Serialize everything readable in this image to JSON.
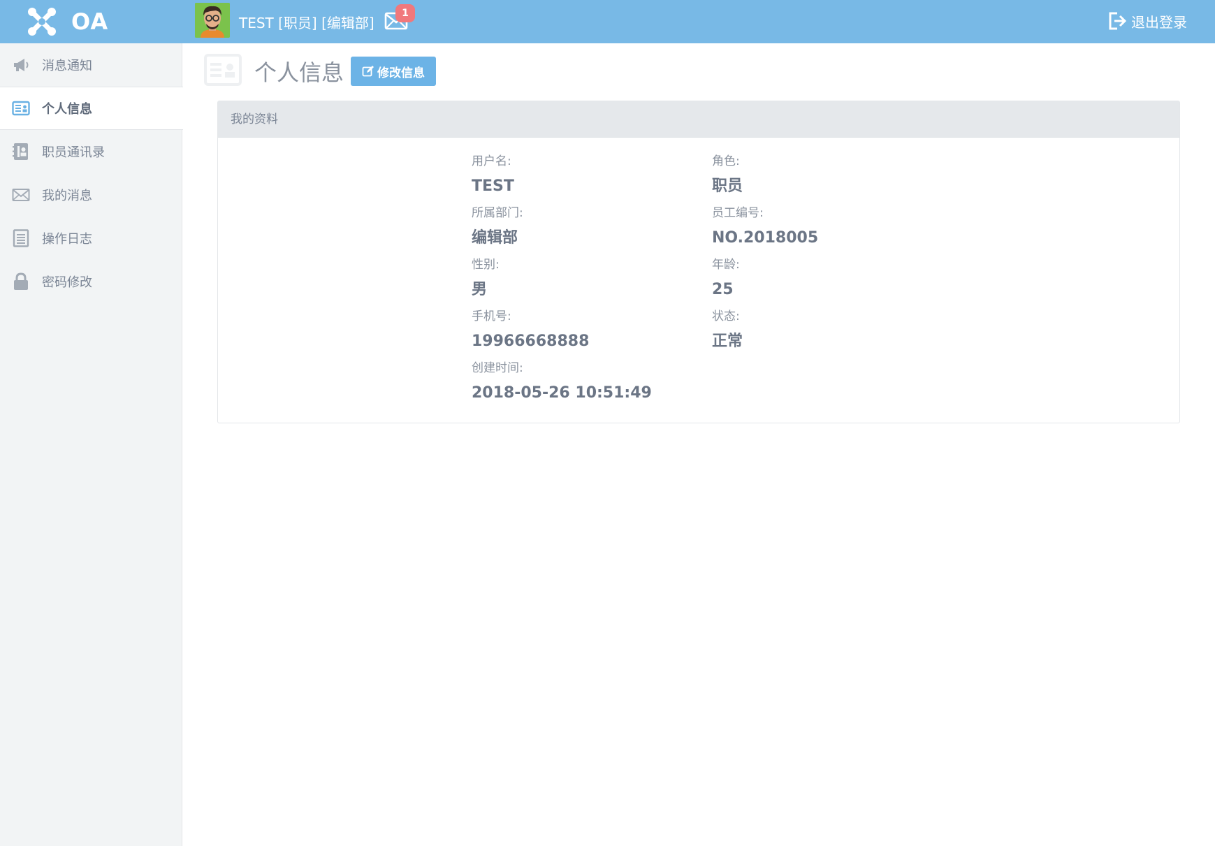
{
  "header": {
    "logo_text": "OA",
    "user_info": "TEST [职员] [编辑部]",
    "mail_badge": "1",
    "logout_label": "退出登录"
  },
  "sidebar": {
    "items": [
      {
        "label": "消息通知",
        "icon": "bullhorn-icon"
      },
      {
        "label": "个人信息",
        "icon": "id-card-icon",
        "active": true
      },
      {
        "label": "职员通讯录",
        "icon": "address-book-icon"
      },
      {
        "label": "我的消息",
        "icon": "envelope-icon"
      },
      {
        "label": "操作日志",
        "icon": "list-doc-icon"
      },
      {
        "label": "密码修改",
        "icon": "lock-icon"
      }
    ]
  },
  "main": {
    "title": "个人信息",
    "edit_button": "修改信息",
    "panel_title": "我的资料",
    "fields": [
      {
        "label": "用户名:",
        "value": "TEST"
      },
      {
        "label": "角色:",
        "value": "职员"
      },
      {
        "label": "所属部门:",
        "value": "编辑部"
      },
      {
        "label": "员工编号:",
        "value": "NO.2018005"
      },
      {
        "label": "性别:",
        "value": "男"
      },
      {
        "label": "年龄:",
        "value": "25"
      },
      {
        "label": "手机号:",
        "value": "19966668888"
      },
      {
        "label": "状态:",
        "value": "正常"
      },
      {
        "label": "创建时间:",
        "value": "2018-05-26 10:51:49"
      }
    ]
  },
  "colors": {
    "topbar": "#78b9e6",
    "accent_button": "#6cb3e6",
    "badge": "#f0787c",
    "sidebar_bg": "#f2f4f5"
  }
}
